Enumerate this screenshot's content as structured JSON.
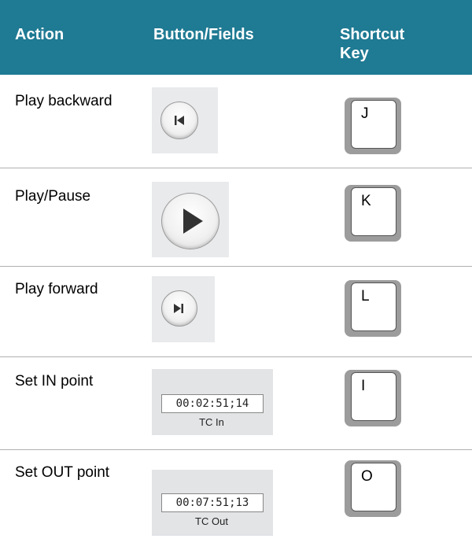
{
  "colors": {
    "header_bg": "#1f7a93",
    "header_text": "#ffffff"
  },
  "header": {
    "action": "Action",
    "button_fields": "Button/Fields",
    "shortcut_key": "Shortcut\nKey"
  },
  "rows": [
    {
      "action": "Play backward",
      "control": "skip-back-icon",
      "key": "J"
    },
    {
      "action": "Play/Pause",
      "control": "play-icon",
      "key": "K"
    },
    {
      "action": "Play forward",
      "control": "skip-forward-icon",
      "key": "L"
    },
    {
      "action": "Set IN point",
      "control": "timecode-field",
      "timecode": "00:02:51;14",
      "timecode_label": "TC In",
      "key": "I"
    },
    {
      "action": "Set OUT point",
      "control": "timecode-field",
      "timecode": "00:07:51;13",
      "timecode_label": "TC Out",
      "key": "O"
    }
  ]
}
